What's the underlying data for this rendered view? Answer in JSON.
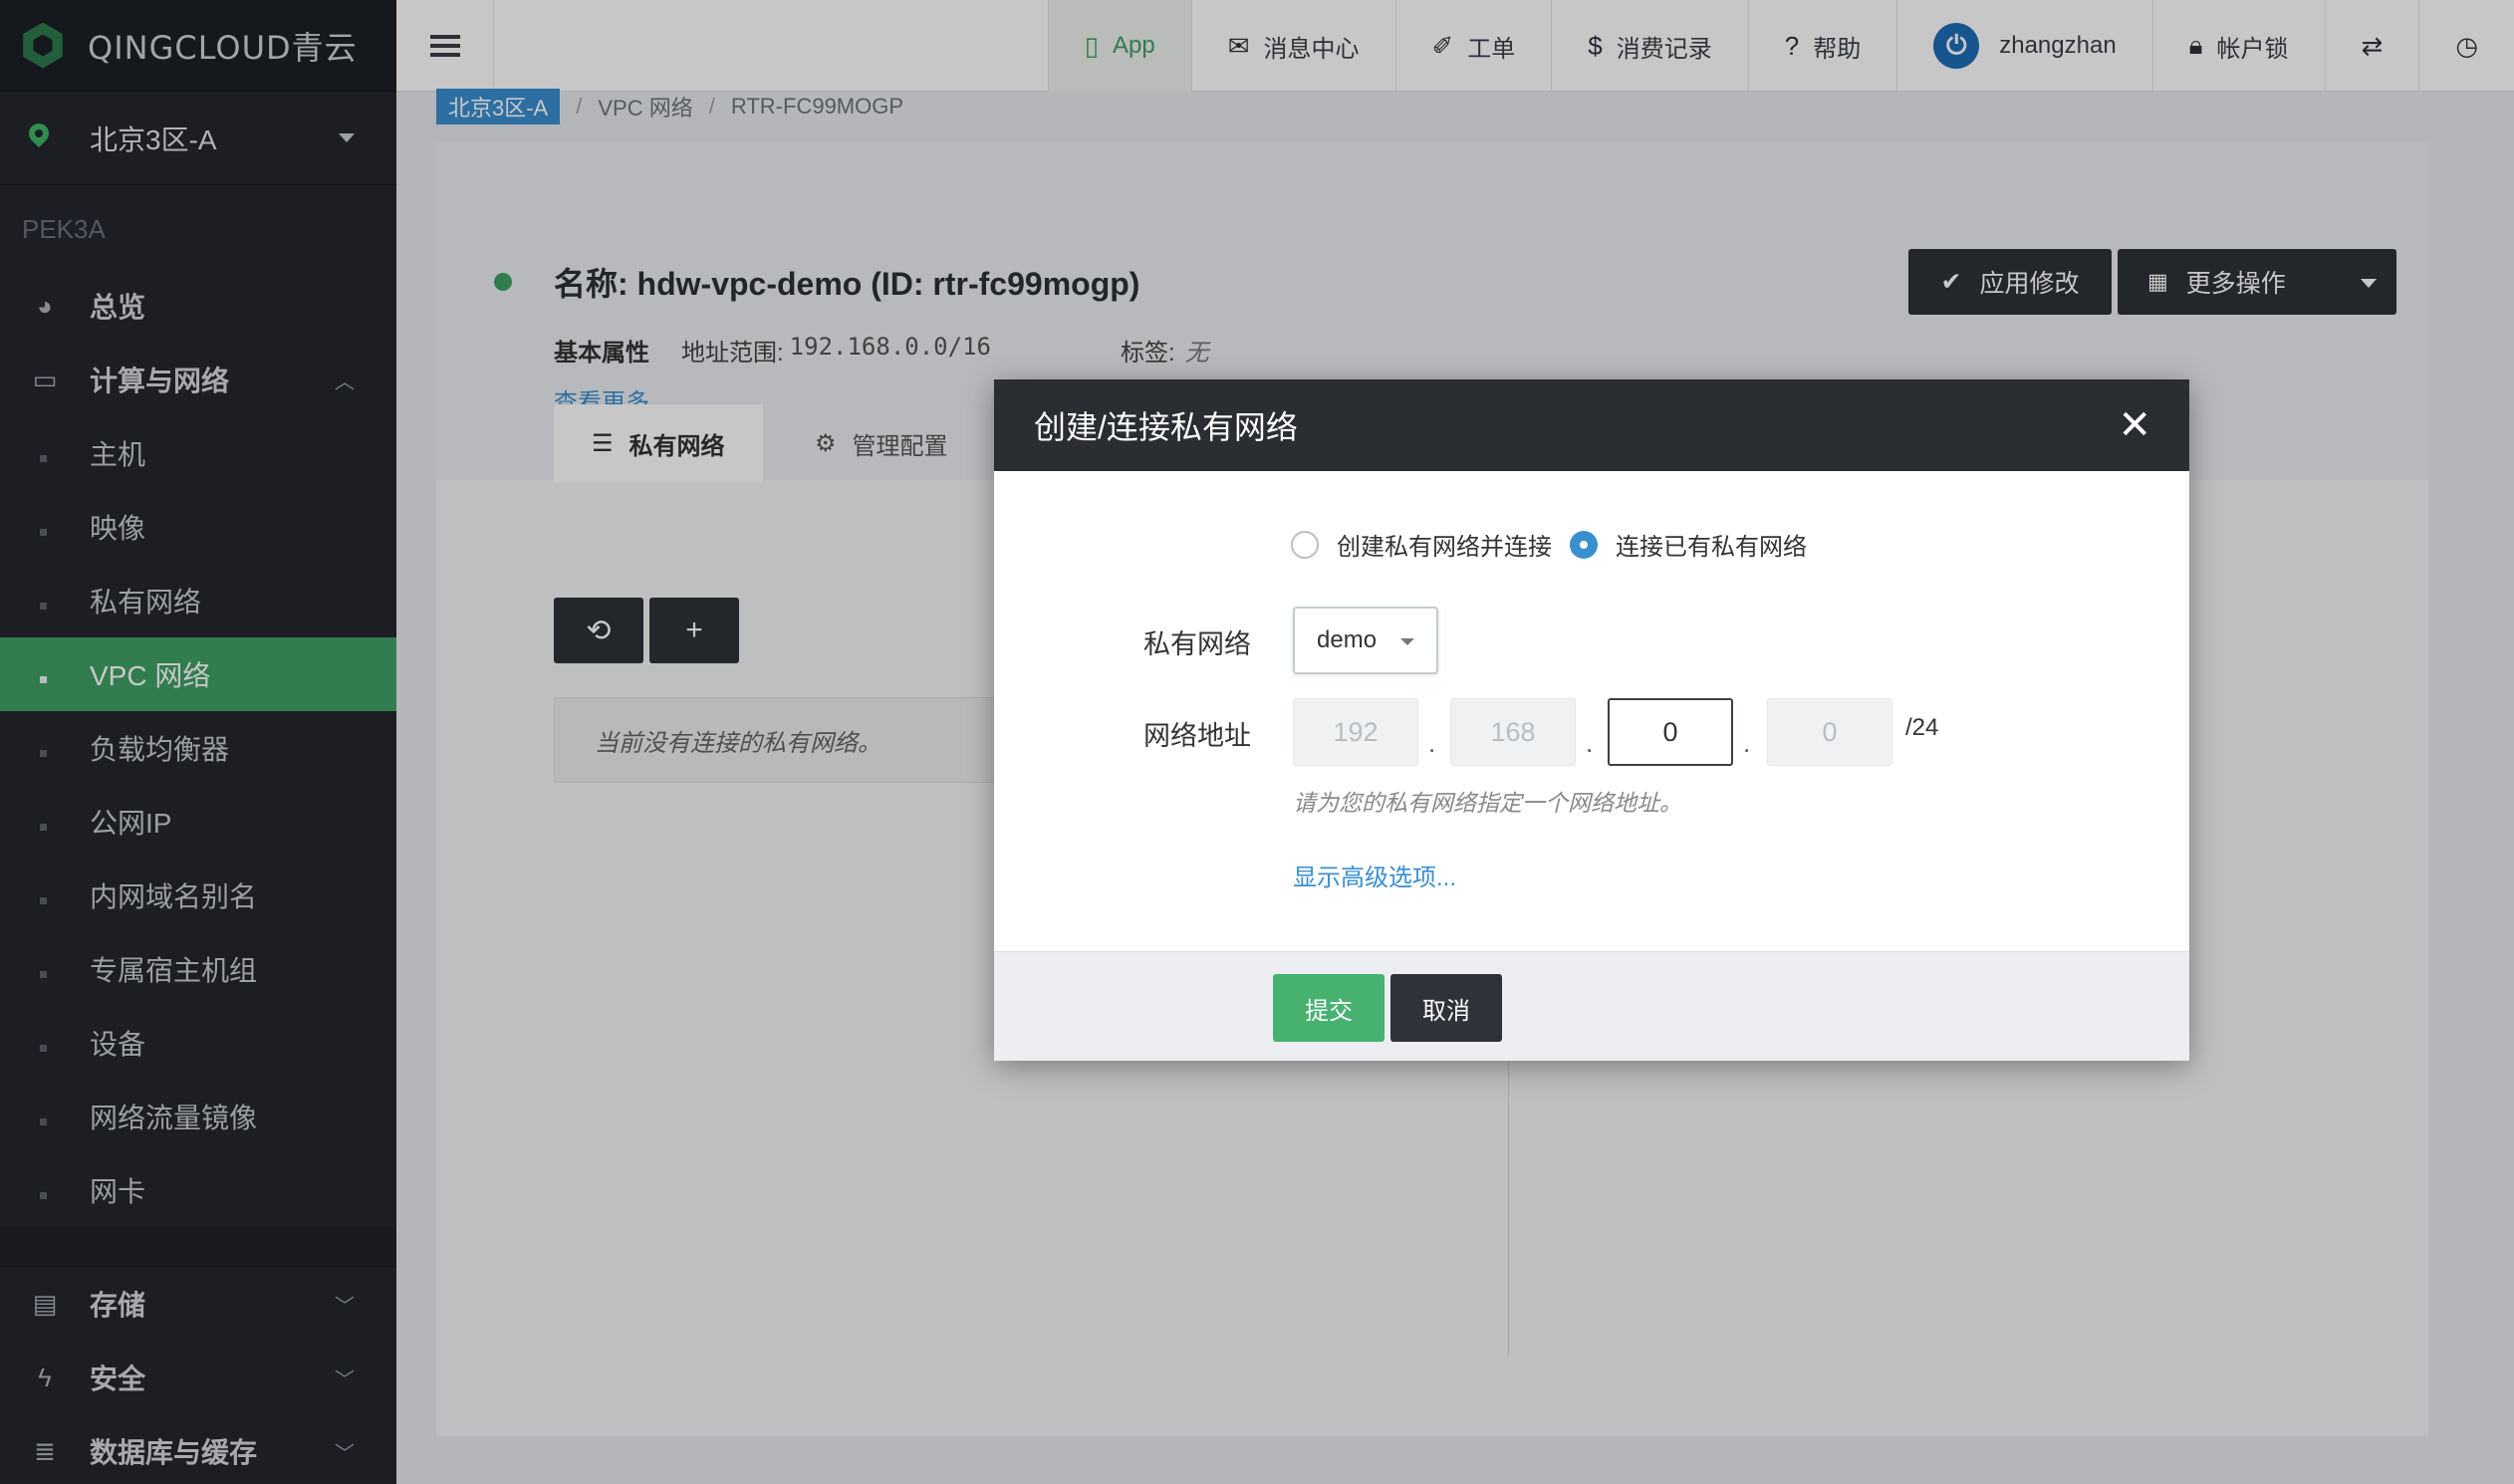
{
  "brand": {
    "name": "QINGCLOUD青云"
  },
  "sidebar": {
    "zone": "北京3区-A",
    "region_code": "PEK3A",
    "overview": "总览",
    "compute_group": "计算与网络",
    "sub_items": [
      "主机",
      "映像",
      "私有网络",
      "VPC 网络",
      "负载均衡器",
      "公网IP",
      "内网域名别名",
      "专属宿主机组",
      "设备",
      "网络流量镜像",
      "网卡"
    ],
    "bottom_groups": [
      "存储",
      "安全",
      "数据库与缓存"
    ]
  },
  "topbar": {
    "app": "App",
    "messages": "消息中心",
    "tickets": "工单",
    "billing": "消费记录",
    "help": "帮助",
    "user": "zhangzhan",
    "lock": "帐户锁"
  },
  "breadcrumb": [
    "北京3区-A",
    "VPC 网络",
    "RTR-FC99MOGP"
  ],
  "resource": {
    "title": "名称: hdw-vpc-demo (ID: rtr-fc99mogp)",
    "basic_props": "基本属性",
    "addr_key": "地址范围:",
    "addr_value": "192.168.0.0/16",
    "tag_key": "标签:",
    "tag_value": "无",
    "see_more": "查看更多...",
    "apply_btn": "应用修改",
    "more_btn": "更多操作"
  },
  "tabs": [
    "私有网络",
    "管理配置"
  ],
  "empty_text": "当前没有连接的私有网络。",
  "modal": {
    "title": "创建/连接私有网络",
    "radio_create": "创建私有网络并连接",
    "radio_connect": "连接已有私有网络",
    "vxnet_label": "私有网络",
    "vxnet_value": "demo",
    "addr_label": "网络地址",
    "octets": [
      "192",
      "168",
      "0",
      "0"
    ],
    "cidr": "/24",
    "hint": "请为您的私有网络指定一个网络地址。",
    "advanced": "显示高级选项...",
    "submit": "提交",
    "cancel": "取消"
  },
  "colors": {
    "accent_green": "#3fa166",
    "link_blue": "#3a8fd0",
    "dark": "#2e3339"
  }
}
